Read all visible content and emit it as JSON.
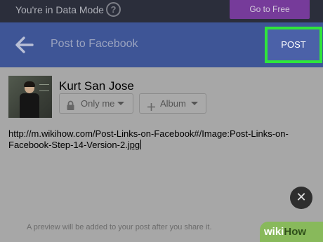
{
  "data_mode_bar": {
    "text": "You're in Data Mode",
    "help_label": "?",
    "go_free_label": "Go to Free"
  },
  "header": {
    "back_icon": "arrow-left-icon",
    "title": "Post to Facebook",
    "post_label": "POST",
    "post_highlight_color": "#2ee63b"
  },
  "composer": {
    "user_name": "Kurt San Jose",
    "privacy_label": "Only me",
    "album_label": "Album",
    "post_text": "http://m.wikihow.com/Post-Links-on-Facebook#/Image:Post-Links-on-Facebook-Step-14-Version-2.",
    "post_text_link_tail": "jpg",
    "close_label": "✕",
    "preview_note": "A preview will be added to your post after you share it."
  },
  "watermark": {
    "wiki": "wiki",
    "how": "How"
  },
  "colors": {
    "header_bg": "#3e5596",
    "data_bar_bg": "#2b2e3b",
    "go_free_bg": "#763b9a"
  }
}
